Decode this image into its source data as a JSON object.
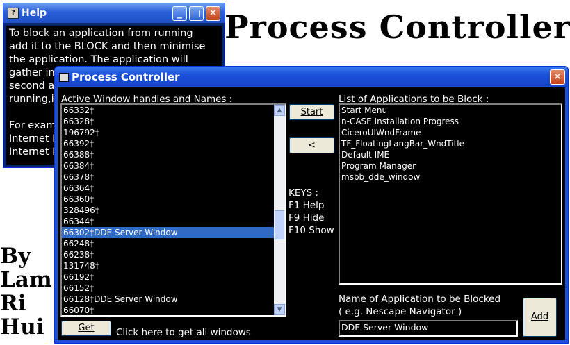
{
  "banner": {
    "title": "Process Controller",
    "author_lines": [
      "By",
      "Lam",
      "Ri",
      "Hui"
    ]
  },
  "help_window": {
    "title": "Help",
    "minimize_glyph": "_",
    "maximize_glyph": "□",
    "close_glyph": "✕",
    "lines": [
      "To block an application from running",
      "add it to the BLOCK and then minimise",
      "the application. The application will",
      "gather inf",
      "second ar",
      "running,it",
      "",
      "For examp",
      "Internet E",
      "Internet E"
    ]
  },
  "main_window": {
    "title": "Process Controller",
    "close_glyph": "✕",
    "active_label": "Active Window handles and Names :",
    "active_items": [
      "66332†",
      "66328†",
      "196792†",
      "66392†",
      "66388†",
      "66384†",
      "66378†",
      "66364†",
      "66360†",
      "328496†",
      "66344†",
      "66302†DDE Server Window",
      "66248†",
      "66238†",
      "131748†",
      "66192†",
      "66152†",
      "66128†DDE Server Window",
      "66070†"
    ],
    "selected_index": 11,
    "start_button": "Start",
    "move_left_button": "<",
    "keys": {
      "heading": "KEYS :",
      "help": "F1    Help",
      "hide": "F9    Hide",
      "show": "F10 Show"
    },
    "block_label": "List of Applications to be Block :",
    "block_items": [
      "Start Menu",
      "n-CASE Installation Progress",
      "CiceroUIWndFrame",
      "TF_FloatingLangBar_WndTitle",
      "Default IME",
      "Program Manager",
      "msbb_dde_window"
    ],
    "name_label_line1": "Name of Application to be Blocked",
    "name_label_line2": "( e.g. Nescape Navigator )",
    "name_value": "DDE Server Window",
    "add_button": "Add",
    "get_button": "Get",
    "get_hint": "Click here to get all windows"
  },
  "colors": {
    "title_blue": "#1f4fd6",
    "selection": "#316ac5",
    "close_red": "#c4421a"
  }
}
